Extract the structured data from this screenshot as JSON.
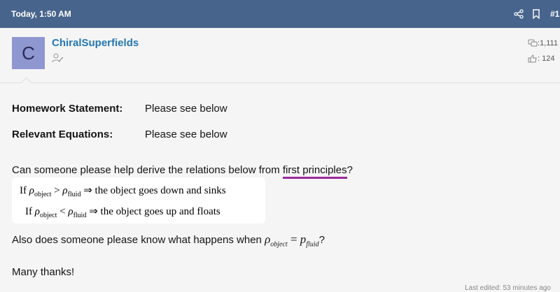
{
  "header": {
    "timestamp": "Today, 1:50 AM",
    "post_number": "#1"
  },
  "author": {
    "avatar_letter": "C",
    "username": "ChiralSuperfields",
    "messages_count": ":1,111",
    "reaction_score": ": 124"
  },
  "post": {
    "homework_label": "Homework Statement:",
    "homework_value": "Please see below",
    "equations_label": "Relevant Equations:",
    "equations_value": "Please see below",
    "question_before": "Can someone please help derive the relations below from ",
    "question_link": "first principles",
    "question_after": "?",
    "math": {
      "row1_if": "If ",
      "row1_rho_obj": "ρ",
      "row1_obj_sub": "object",
      "row1_op": " > ",
      "row1_rho_fluid": "ρ",
      "row1_fluid_sub": "fluid",
      "row1_result": " ⇒ the object goes down and sinks",
      "row2_if": "If ",
      "row2_rho_obj": "ρ",
      "row2_obj_sub": "object",
      "row2_op": " < ",
      "row2_rho_fluid": "ρ",
      "row2_fluid_sub": "fluid",
      "row2_result": " ⇒ the object goes up and floats"
    },
    "also_before": "Also does someone please know what happens when ",
    "also_rho": "ρ",
    "also_obj_sub": "object",
    "also_eq": " = ",
    "also_p": "p",
    "also_fluid_sub": "fluid",
    "also_after": "?",
    "thanks": "Many thanks!",
    "last_edited": "Last edited: 53 minutes ago"
  },
  "icons": {
    "share": "share-icon",
    "bookmark": "bookmark-icon",
    "user": "user-edit-icon",
    "messages": "messages-icon",
    "reactions": "thumbs-up-icon"
  },
  "colors": {
    "header_bg": "#47648c",
    "username": "#2577b1",
    "avatar_bg": "#8f97d1",
    "link_underline": "#9b2a9b"
  }
}
